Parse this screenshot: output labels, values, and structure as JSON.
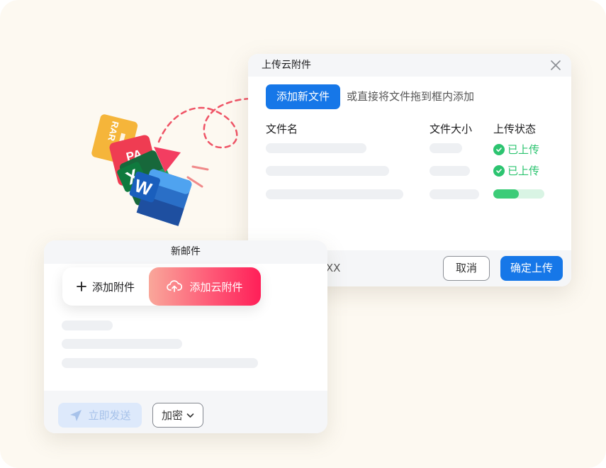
{
  "colors": {
    "background": "#fdf9f1",
    "primary": "#1677e8",
    "success": "#2cc470",
    "cloud_gradient_end": "#ff1f58",
    "dashed_path": "#ef5466"
  },
  "illustration": {
    "rar_label": "RAR",
    "pdf_label": "PA",
    "excel_label": "X",
    "word_label": "W"
  },
  "upload_dialog": {
    "title": "上传云附件",
    "add_file_label": "添加新文件",
    "drag_hint": "或直接将文件拖到框内添加",
    "columns": {
      "name": "文件名",
      "size": "文件大小",
      "status": "上传状态"
    },
    "rows": [
      {
        "status": "已上传",
        "progress": 1.0
      },
      {
        "status": "已上传",
        "progress": 1.0
      },
      {
        "status": "",
        "progress": 0.5
      }
    ],
    "total_size": "文件总大小: XX",
    "cancel_label": "取消",
    "confirm_label": "确定上传"
  },
  "compose": {
    "title": "新邮件",
    "add_attachment_label": "添加附件",
    "add_cloud_attachment_label": "添加云附件",
    "send_label": "立即发送",
    "encrypt_label": "加密"
  }
}
